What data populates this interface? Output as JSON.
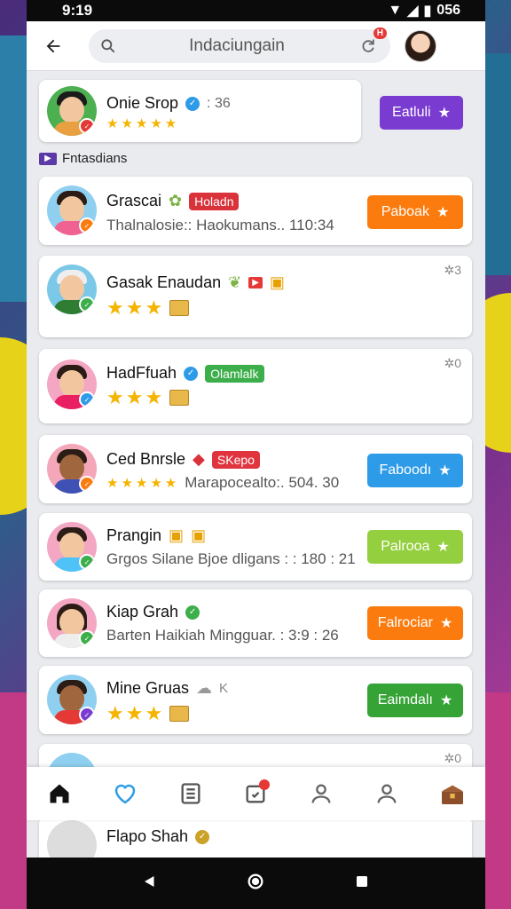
{
  "status": {
    "time": "9:19",
    "battery": "056"
  },
  "topbar": {
    "search_text": "Indaciungain",
    "refresh_badge": "H"
  },
  "featured": {
    "name": "Onie Srop",
    "meta": ": 36",
    "stars": "★★★★★",
    "button_label": "Eatluli"
  },
  "section": {
    "label": "Fntasdians"
  },
  "items": [
    {
      "name": "Grascai",
      "tag": "Holadn",
      "sub": "Thalnalosie:: Haokumans.. 110:34",
      "button_label": "Paboak",
      "button_color": "#fb7b0e"
    },
    {
      "name": "Gasak Enaudan",
      "count": "3",
      "stars": "★★★"
    },
    {
      "name": "HadFfuah",
      "tag": "Olamlalk",
      "count": "0",
      "stars": "★★★"
    },
    {
      "name": "Ced Bnrsle",
      "tag": "SKepo",
      "stars": "★★★★★",
      "sub": "Marapocealto:. 504. 30",
      "button_label": "Faboodı",
      "button_color": "#2e9be8"
    },
    {
      "name": "Prangin",
      "sub": "Grgos Silane Bjoe dligans : : 180 : 21",
      "button_label": "Palrooa",
      "button_color": "#93cf3e"
    },
    {
      "name": "Kiap Grah",
      "sub": "Barten Haikiah Mingguar. : 3:9 : 26",
      "button_label": "Falrociar",
      "button_color": "#fb7b0e"
    },
    {
      "name": "Mine Gruas",
      "extra": "K",
      "stars": "★★★",
      "button_label": "Eaimdalı",
      "button_color": "#36a336"
    },
    {
      "count": "0"
    },
    {
      "name": "Flapo Shah"
    }
  ]
}
